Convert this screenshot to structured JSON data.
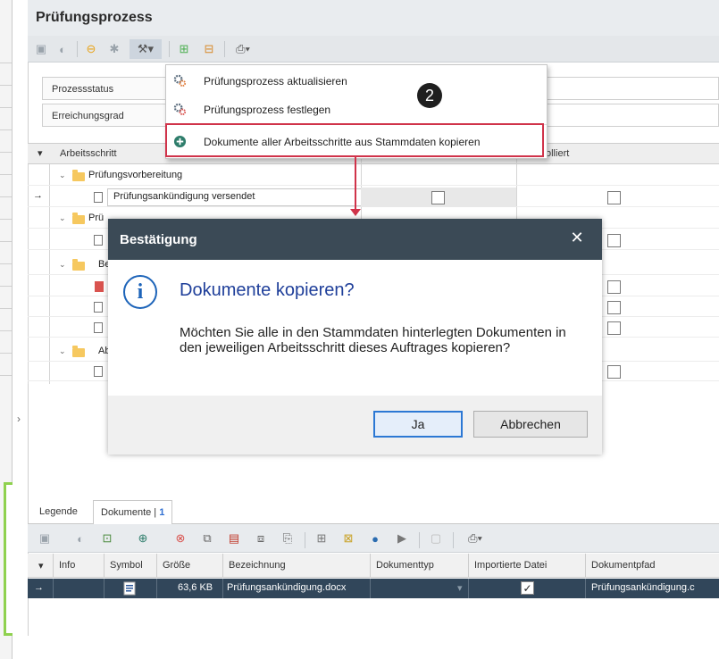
{
  "header": {
    "title": "Prüfungsprozess"
  },
  "status": {
    "process_status_label": "Prozessstatus",
    "achievement_label": "Erreichungsgrad"
  },
  "tree": {
    "columns": [
      "Arbeitsschritt",
      "olliert"
    ],
    "rows": [
      {
        "label": "Prüfungsvorbereitung",
        "type": "folder"
      },
      {
        "label": "Prüfungsankündigung versendet",
        "type": "doc",
        "current": true
      },
      {
        "label": "Prü",
        "type": "folder"
      },
      {
        "label": "",
        "type": "doc"
      },
      {
        "label": "Be",
        "type": "folder"
      },
      {
        "label": "",
        "type": "doc-red"
      },
      {
        "label": "",
        "type": "doc"
      },
      {
        "label": "",
        "type": "doc"
      },
      {
        "label": "Ab",
        "type": "folder"
      },
      {
        "label": "",
        "type": "doc"
      }
    ],
    "current_marker": "→"
  },
  "menu": {
    "items": [
      {
        "label": "Prüfungsprozess aktualisieren",
        "icon": "gears-icon"
      },
      {
        "label": "Prüfungsprozess festlegen",
        "icon": "gears-icon"
      },
      {
        "label": "Dokumente aller Arbeitsschritte aus Stammdaten kopieren",
        "icon": "add-circle-icon"
      }
    ]
  },
  "annotation": {
    "step": "2",
    "color": "#d0334a"
  },
  "dialog": {
    "title": "Bestätigung",
    "close": "✕",
    "heading": "Dokumente kopieren?",
    "message": "Möchten Sie alle in den Stammdaten hinterlegten Dokumenten in den jeweiligen Arbeitsschritt dieses Auftrages kopieren?",
    "ok_label": "Ja",
    "cancel_label": "Abbrechen"
  },
  "bottom": {
    "tabs": {
      "legend": "Legende",
      "documents": "Dokumente |",
      "documents_count": "1"
    },
    "columns": [
      "Info",
      "Symbol",
      "Größe",
      "Bezeichnung",
      "Dokumenttyp",
      "Importierte Datei",
      "Dokumentpfad"
    ],
    "rows": [
      {
        "marker": "→",
        "size": "63,6 KB",
        "name": "Prüfungsankündigung.docx",
        "type": "",
        "imported": "✓",
        "path": "Prüfungsankündigung.c"
      }
    ]
  }
}
